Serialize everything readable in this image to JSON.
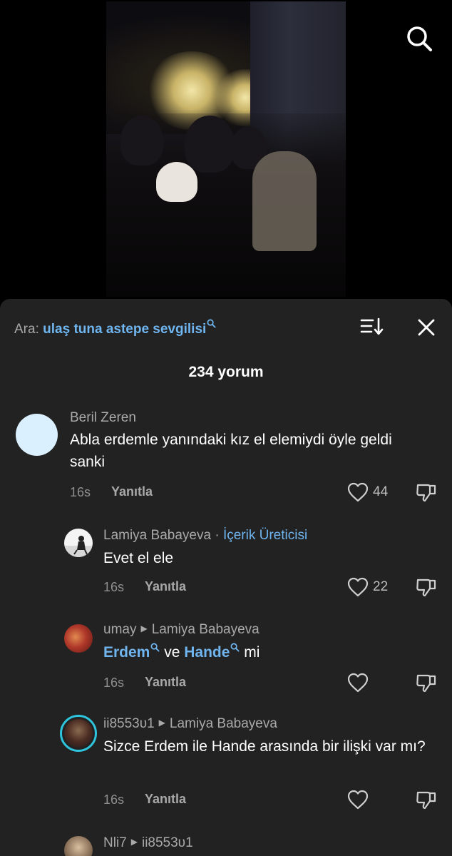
{
  "search_bar": {
    "prefix": "Ara:",
    "query": "ulaş tuna astepe sevgilisi"
  },
  "comment_count": "234 yorum",
  "reply_label": "Yanıtla",
  "comments": [
    {
      "user": "Beril Zeren",
      "text": "Abla erdemle yanındaki kız el elemiydi öyle geldi sanki",
      "time": "16s",
      "likes": "44"
    },
    {
      "user": "Lamiya Babayeva",
      "badge_sep": "·",
      "badge": "İçerik Üreticisi",
      "text": "Evet el ele",
      "time": "16s",
      "likes": "22"
    },
    {
      "user": "umay",
      "reply_to": "Lamiya Babayeva",
      "link1": "Erdem",
      "mid": "ve",
      "link2": "Hande",
      "end": "mi",
      "time": "16s"
    },
    {
      "user": "ii8553υ1",
      "reply_to": "Lamiya Babayeva",
      "text": "Sizce Erdem ile Hande arasında bir ilişki var mı?",
      "time": "16s"
    },
    {
      "user": "Nli7",
      "reply_to": "ii8553υ1"
    }
  ],
  "colors": {
    "sheet_bg": "#222222",
    "link": "#6fb5f0",
    "muted": "#a9a9a9"
  }
}
